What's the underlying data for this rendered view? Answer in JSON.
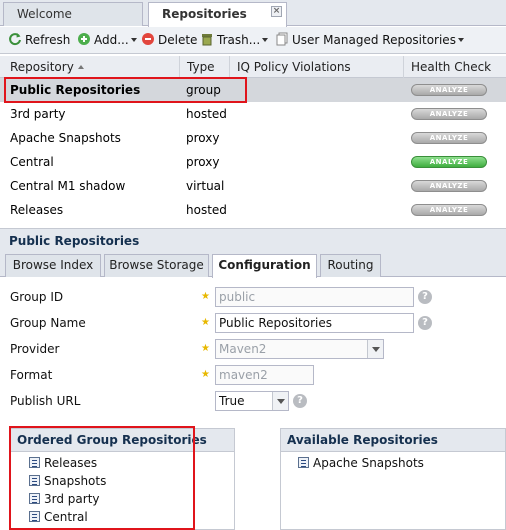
{
  "top_tabs": [
    {
      "label": "Welcome",
      "active": false
    },
    {
      "label": "Repositories",
      "active": true,
      "close": "×"
    }
  ],
  "toolbar": {
    "refresh": "Refresh",
    "add": "Add...",
    "delete": "Delete",
    "trash": "Trash...",
    "user_managed": "User Managed Repositories"
  },
  "grid": {
    "columns": [
      "Repository",
      "Type",
      "IQ Policy Violations",
      "Health Check"
    ],
    "rows": [
      {
        "name": "Public Repositories",
        "type": "group",
        "iq": "",
        "health": "ANALYZE",
        "health_status": "gray",
        "selected": true
      },
      {
        "name": "3rd party",
        "type": "hosted",
        "iq": "",
        "health": "ANALYZE",
        "health_status": "gray"
      },
      {
        "name": "Apache Snapshots",
        "type": "proxy",
        "iq": "",
        "health": "ANALYZE",
        "health_status": "gray"
      },
      {
        "name": "Central",
        "type": "proxy",
        "iq": "",
        "health": "ANALYZE",
        "health_status": "green"
      },
      {
        "name": "Central M1 shadow",
        "type": "virtual",
        "iq": "",
        "health": "ANALYZE",
        "health_status": "gray"
      },
      {
        "name": "Releases",
        "type": "hosted",
        "iq": "",
        "health": "ANALYZE",
        "health_status": "gray"
      }
    ]
  },
  "detail": {
    "title": "Public Repositories",
    "tabs": [
      {
        "label": "Browse Index",
        "active": false
      },
      {
        "label": "Browse Storage",
        "active": false
      },
      {
        "label": "Configuration",
        "active": true
      },
      {
        "label": "Routing",
        "active": false
      }
    ],
    "form": {
      "group_id_label": "Group ID",
      "group_id_value": "public",
      "group_name_label": "Group Name",
      "group_name_value": "Public Repositories",
      "provider_label": "Provider",
      "provider_value": "Maven2",
      "format_label": "Format",
      "format_value": "maven2",
      "publish_url_label": "Publish URL",
      "publish_url_value": "True",
      "required_mark": "★",
      "help_mark": "?"
    },
    "ordered": {
      "title": "Ordered Group Repositories",
      "items": [
        "Releases",
        "Snapshots",
        "3rd party",
        "Central"
      ]
    },
    "available": {
      "title": "Available Repositories",
      "items": [
        "Apache Snapshots"
      ]
    }
  },
  "colors": {
    "highlight": "#e0141b",
    "selected_row": "#d4d7dc",
    "header_text": "#15304f"
  }
}
